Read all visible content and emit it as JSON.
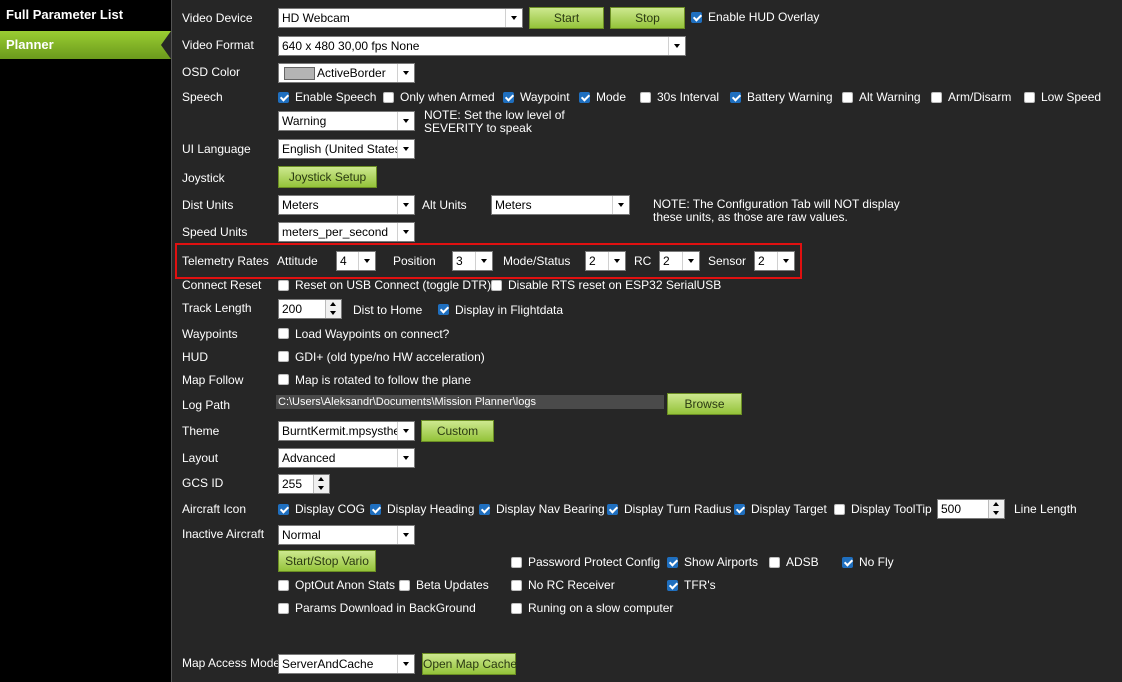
{
  "sidebar": {
    "items": [
      {
        "label": "Full Parameter List"
      },
      {
        "label": "Planner"
      }
    ]
  },
  "video": {
    "device_label": "Video Device",
    "device_value": "HD Webcam",
    "start_label": "Start",
    "stop_label": "Stop",
    "hud_overlay_label": "Enable HUD Overlay",
    "hud_overlay_checked": true,
    "format_label": "Video Format",
    "format_value": "640 x 480 30,00 fps None"
  },
  "osd": {
    "label": "OSD Color",
    "value": "ActiveBorder",
    "swatch": "#b4b4b4"
  },
  "speech": {
    "label": "Speech",
    "options": [
      {
        "label": "Enable Speech",
        "checked": true
      },
      {
        "label": "Only when Armed",
        "checked": false
      },
      {
        "label": "Waypoint",
        "checked": true
      },
      {
        "label": "Mode",
        "checked": true
      },
      {
        "label": "30s Interval",
        "checked": false
      },
      {
        "label": "Battery Warning",
        "checked": true
      },
      {
        "label": "Alt Warning",
        "checked": false
      },
      {
        "label": "Arm/Disarm",
        "checked": false
      },
      {
        "label": "Low Speed",
        "checked": false
      }
    ],
    "severity_value": "Warning",
    "note_line1": "NOTE: Set the low level of",
    "note_line2": "SEVERITY to speak"
  },
  "ui_language": {
    "label": "UI Language",
    "value": "English (United States)"
  },
  "joystick": {
    "label": "Joystick",
    "button": "Joystick Setup"
  },
  "units": {
    "dist_label": "Dist Units",
    "dist_value": "Meters",
    "alt_label": "Alt Units",
    "alt_value": "Meters",
    "note_line1": "NOTE: The Configuration Tab will NOT display",
    "note_line2": "these units, as those are raw values.",
    "speed_label": "Speed Units",
    "speed_value": "meters_per_second"
  },
  "telemetry": {
    "label": "Telemetry Rates",
    "attitude_label": "Attitude",
    "attitude_value": "4",
    "position_label": "Position",
    "position_value": "3",
    "mode_label": "Mode/Status",
    "mode_value": "2",
    "rc_label": "RC",
    "rc_value": "2",
    "sensor_label": "Sensor",
    "sensor_value": "2"
  },
  "connect_reset": {
    "label": "Connect Reset",
    "usb_label": "Reset on USB Connect (toggle DTR)",
    "usb_checked": false,
    "rts_label": "Disable RTS reset on ESP32 SerialUSB",
    "rts_checked": false
  },
  "track": {
    "label": "Track Length",
    "value": "200",
    "dist_home_label": "Dist to Home",
    "flightdata_label": "Display in Flightdata",
    "flightdata_checked": true
  },
  "waypoints": {
    "label": "Waypoints",
    "check_label": "Load Waypoints on connect?",
    "checked": false
  },
  "hud": {
    "label": "HUD",
    "check_label": "GDI+ (old type/no HW acceleration)",
    "checked": false
  },
  "map_follow": {
    "label": "Map Follow",
    "check_label": "Map is rotated to follow the plane",
    "checked": false
  },
  "log_path": {
    "label": "Log Path",
    "value": "C:\\Users\\Aleksandr\\Documents\\Mission Planner\\logs",
    "browse": "Browse"
  },
  "theme": {
    "label": "Theme",
    "value": "BurntKermit.mpsystheme",
    "custom": "Custom"
  },
  "layout": {
    "label": "Layout",
    "value": "Advanced"
  },
  "gcs": {
    "label": "GCS ID",
    "value": "255"
  },
  "aircraft_icon": {
    "label": "Aircraft Icon",
    "options": [
      {
        "label": "Display COG",
        "checked": true
      },
      {
        "label": "Display Heading",
        "checked": true
      },
      {
        "label": "Display Nav Bearing",
        "checked": true
      },
      {
        "label": "Display Turn Radius",
        "checked": true
      },
      {
        "label": "Display Target",
        "checked": true
      },
      {
        "label": "Display ToolTip",
        "checked": false
      }
    ],
    "line_length_value": "500",
    "line_length_label": "Line Length"
  },
  "inactive": {
    "label": "Inactive Aircraft",
    "value": "Normal"
  },
  "misc": {
    "vario_button": "Start/Stop Vario",
    "optout": {
      "label": "OptOut Anon Stats",
      "checked": false
    },
    "beta": {
      "label": "Beta Updates",
      "checked": false
    },
    "params_bg": {
      "label": "Params Download in BackGround",
      "checked": false
    },
    "password": {
      "label": "Password Protect Config",
      "checked": false
    },
    "no_rc": {
      "label": "No RC Receiver",
      "checked": false
    },
    "slow": {
      "label": "Runing on a slow computer",
      "checked": false
    },
    "airports": {
      "label": "Show Airports",
      "checked": true
    },
    "tfr": {
      "label": "TFR's",
      "checked": true
    },
    "adsb": {
      "label": "ADSB",
      "checked": false
    },
    "nofly": {
      "label": "No Fly",
      "checked": true
    }
  },
  "map_access": {
    "label": "Map Access Mode",
    "value": "ServerAndCache",
    "button": "Open Map Cache"
  },
  "colors": {
    "accent": "#8cc63f",
    "highlight_box": "#e01010",
    "check_blue": "#1f6fbf"
  }
}
